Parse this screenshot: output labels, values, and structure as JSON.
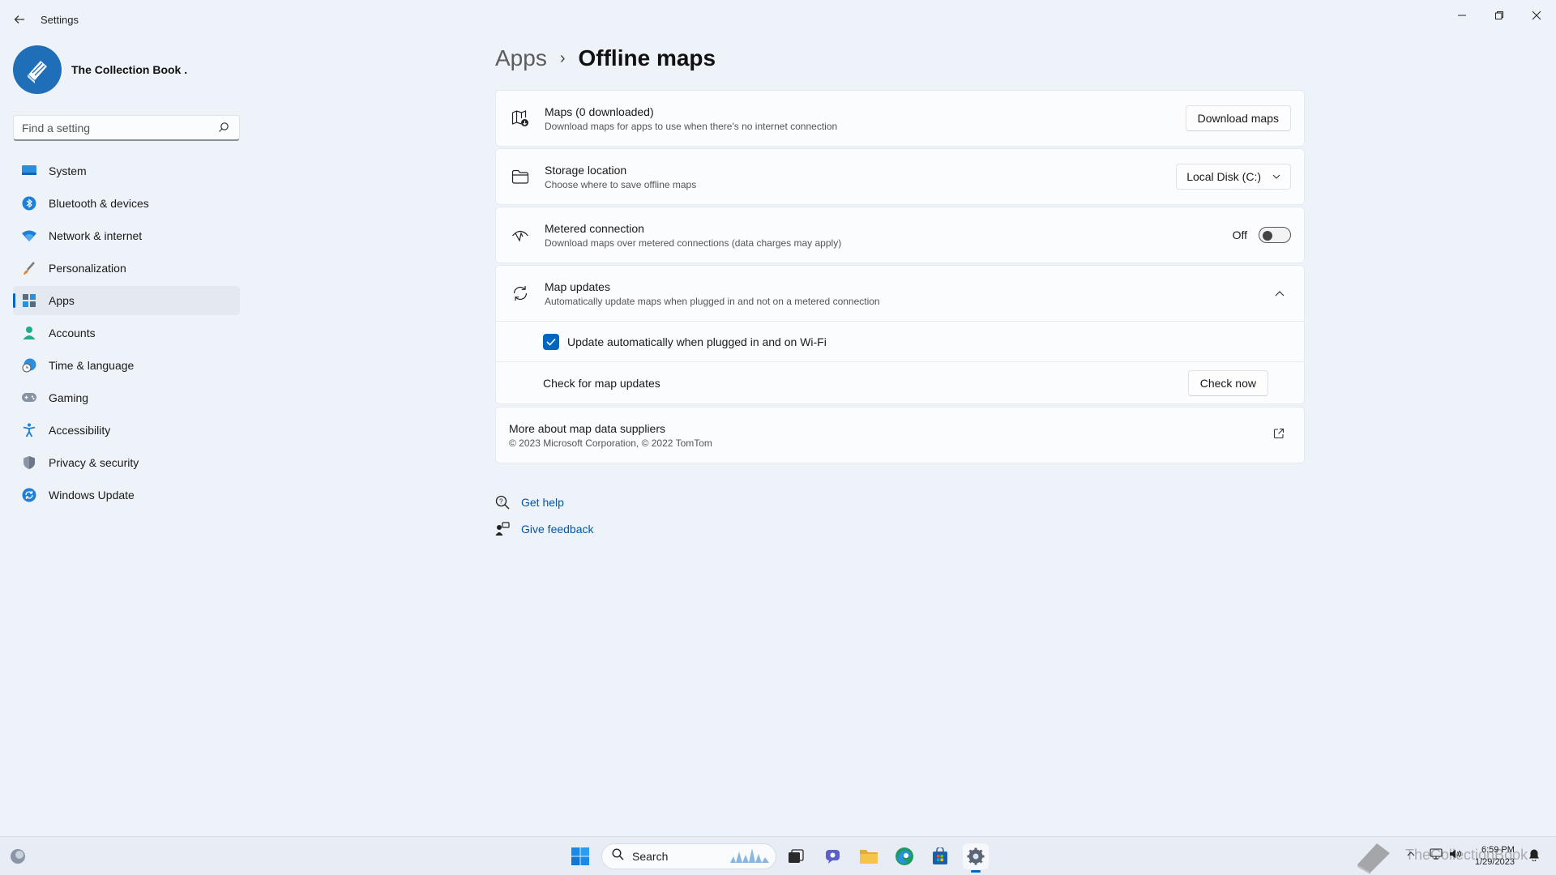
{
  "window": {
    "title": "Settings"
  },
  "profile": {
    "name": "The Collection Book ."
  },
  "search": {
    "placeholder": "Find a setting"
  },
  "sidebar": {
    "items": [
      {
        "label": "System",
        "icon": "system-icon"
      },
      {
        "label": "Bluetooth & devices",
        "icon": "bluetooth-icon"
      },
      {
        "label": "Network & internet",
        "icon": "wifi-icon"
      },
      {
        "label": "Personalization",
        "icon": "brush-icon"
      },
      {
        "label": "Apps",
        "icon": "apps-icon",
        "active": true
      },
      {
        "label": "Accounts",
        "icon": "person-icon"
      },
      {
        "label": "Time & language",
        "icon": "globe-clock-icon"
      },
      {
        "label": "Gaming",
        "icon": "gamepad-icon"
      },
      {
        "label": "Accessibility",
        "icon": "accessibility-icon"
      },
      {
        "label": "Privacy & security",
        "icon": "shield-icon"
      },
      {
        "label": "Windows Update",
        "icon": "update-icon"
      }
    ]
  },
  "breadcrumb": {
    "parent": "Apps",
    "separator": "›",
    "current": "Offline maps"
  },
  "cards": {
    "maps": {
      "title": "Maps (0 downloaded)",
      "subtitle": "Download maps for apps to use when there's no internet connection",
      "button": "Download maps"
    },
    "storage": {
      "title": "Storage location",
      "subtitle": "Choose where to save offline maps",
      "selected": "Local Disk (C:)"
    },
    "metered": {
      "title": "Metered connection",
      "subtitle": "Download maps over metered connections (data charges may apply)",
      "state_label": "Off"
    },
    "updates": {
      "title": "Map updates",
      "subtitle": "Automatically update maps when plugged in and not on a metered connection",
      "auto_update_label": "Update automatically when plugged in and on Wi-Fi",
      "check_label": "Check for map updates",
      "check_button": "Check now"
    },
    "suppliers": {
      "title": "More about map data suppliers",
      "subtitle": "© 2023 Microsoft Corporation, © 2022 TomTom"
    }
  },
  "links": {
    "help": "Get help",
    "feedback": "Give feedback"
  },
  "taskbar": {
    "search_label": "Search",
    "time": "6:59 PM",
    "date": "1/29/2023",
    "watermark": "TheCollectionBook"
  },
  "colors": {
    "accent": "#0067c0",
    "background": "#eef2f9",
    "card": "#fbfcfe"
  }
}
